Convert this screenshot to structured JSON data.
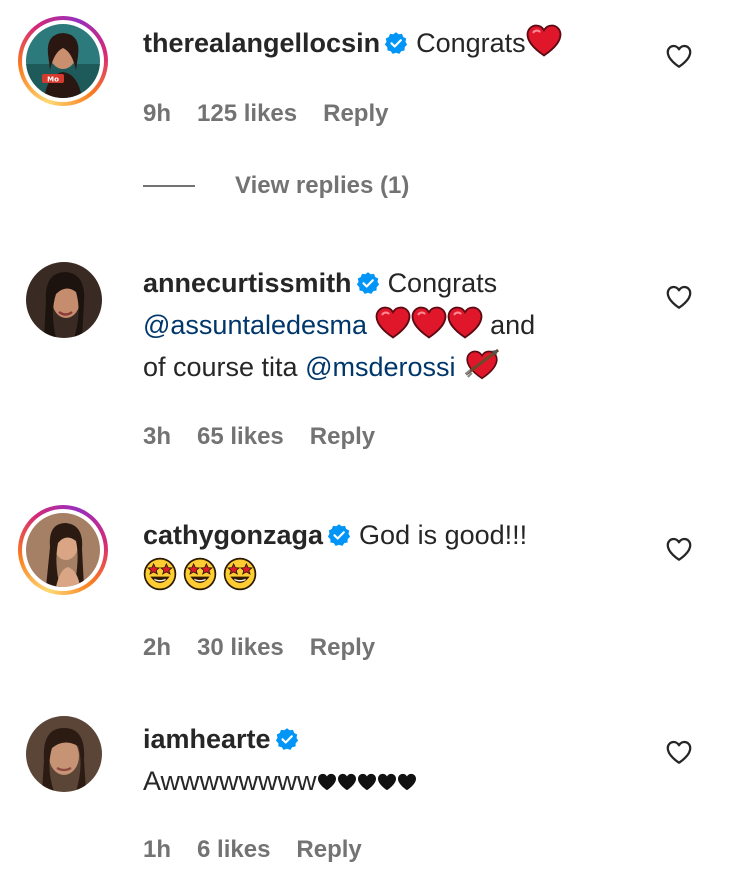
{
  "comments": [
    {
      "username": "therealangellocsin",
      "text_before": "Congrats",
      "time": "9h",
      "likes": "125 likes",
      "reply": "Reply",
      "view_replies": "View replies (1)"
    },
    {
      "username": "annecurtissmith",
      "line1": "Congrats",
      "mention1": "@assuntaledesma",
      "text_and": "and",
      "text_course": "of course tita",
      "mention2": "@msderossi",
      "time": "3h",
      "likes": "65 likes",
      "reply": "Reply"
    },
    {
      "username": "cathygonzaga",
      "text": "God is good!!!",
      "time": "2h",
      "likes": "30 likes",
      "reply": "Reply"
    },
    {
      "username": "iamhearte",
      "text": "Awwwwwwww",
      "time": "1h",
      "likes": "6 likes",
      "reply": "Reply"
    }
  ],
  "colors": {
    "verified": "#0095f6",
    "heart_emoji": "#e0162b",
    "mention": "#00376b",
    "meta": "#737373"
  },
  "icons": {
    "like": "heart-outline-icon",
    "verified": "verified-badge-icon"
  }
}
